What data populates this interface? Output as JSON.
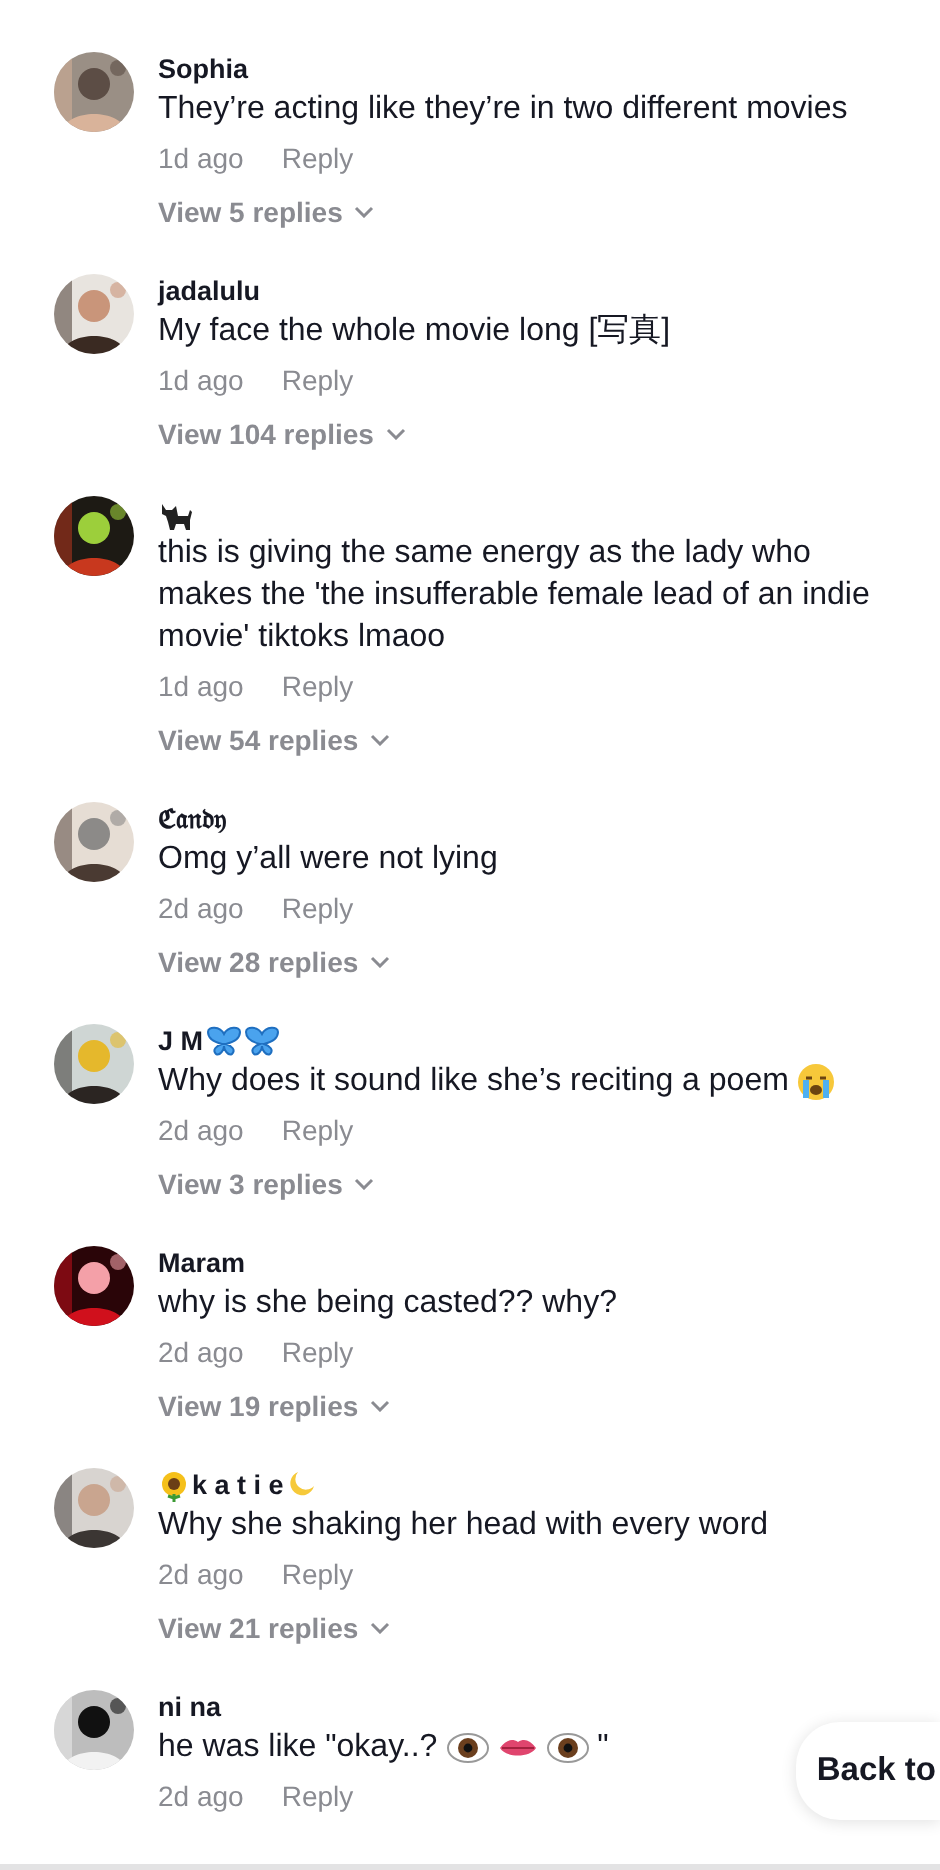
{
  "comments": [
    {
      "user": [
        {
          "kind": "text",
          "text": "Sophia"
        }
      ],
      "body": [
        {
          "kind": "text",
          "text": "They’re acting like they’re in two different movies"
        }
      ],
      "time": "1d ago",
      "reply": "Reply",
      "replies": "View 5 replies",
      "avatar": {
        "kind": "picture"
      }
    },
    {
      "user": [
        {
          "kind": "text",
          "text": "jadalulu"
        }
      ],
      "body": [
        {
          "kind": "text",
          "text": "My face the whole movie long [写真]"
        }
      ],
      "time": "1d ago",
      "reply": "Reply",
      "replies": "View 104 replies",
      "avatar": {
        "kind": "picture"
      }
    },
    {
      "user": [
        {
          "kind": "cat"
        }
      ],
      "body": [
        {
          "kind": "text",
          "text": "this is giving the same energy as the lady who makes the 'the insufferable female lead of an indie movie' tiktoks lmaoo"
        }
      ],
      "time": "1d ago",
      "reply": "Reply",
      "replies": "View 54 replies",
      "avatar": {
        "kind": "picture"
      }
    },
    {
      "user": [
        {
          "kind": "text",
          "text": "ℭ𝔞𝔫𝔡𝔶"
        }
      ],
      "body": [
        {
          "kind": "text",
          "text": "Omg y’all were not lying"
        }
      ],
      "time": "2d ago",
      "reply": "Reply",
      "replies": "View 28 replies",
      "avatar": {
        "kind": "picture"
      }
    },
    {
      "user": [
        {
          "kind": "text",
          "text": "J M"
        },
        {
          "kind": "butterfly"
        },
        {
          "kind": "butterfly"
        }
      ],
      "body": [
        {
          "kind": "text",
          "text": "Why does it sound like she’s reciting a poem"
        },
        {
          "kind": "crying"
        }
      ],
      "time": "2d ago",
      "reply": "Reply",
      "replies": "View 3 replies",
      "avatar": {
        "kind": "picture"
      }
    },
    {
      "user": [
        {
          "kind": "text",
          "text": "Maram"
        }
      ],
      "body": [
        {
          "kind": "text",
          "text": "why is she being casted?? why?"
        }
      ],
      "time": "2d ago",
      "reply": "Reply",
      "replies": "View 19 replies",
      "avatar": {
        "kind": "picture"
      }
    },
    {
      "user": [
        {
          "kind": "sunflower"
        },
        {
          "kind": "text",
          "text": "k a t i e"
        },
        {
          "kind": "moon"
        }
      ],
      "body": [
        {
          "kind": "text",
          "text": "Why she shaking her head with every word"
        }
      ],
      "time": "2d ago",
      "reply": "Reply",
      "replies": "View 21 replies",
      "avatar": {
        "kind": "picture"
      }
    },
    {
      "user": [
        {
          "kind": "text",
          "text": "ni na"
        }
      ],
      "body": [
        {
          "kind": "text",
          "text": "he was like \"okay..?"
        },
        {
          "kind": "eye"
        },
        {
          "kind": "lips"
        },
        {
          "kind": "eye"
        },
        {
          "kind": "text",
          "text": "\""
        }
      ],
      "time": "2d ago",
      "reply": "Reply",
      "avatar": {
        "kind": "picture"
      }
    }
  ],
  "back_to_top": "Back to"
}
